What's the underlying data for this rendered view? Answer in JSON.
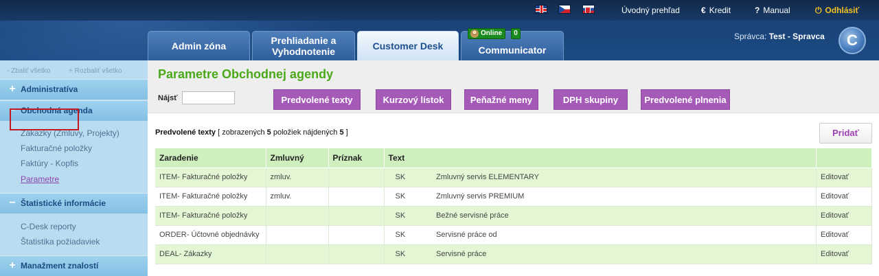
{
  "header": {
    "flags": [
      "uk-flag",
      "cz-flag",
      "sk-flag"
    ],
    "links": {
      "overview": "Úvodný prehľad",
      "credit": "Kredit",
      "manual": "Manual",
      "logout": "Odhlásiť"
    },
    "credit_icon": "€",
    "manual_icon": "?",
    "logout_icon": "⏻",
    "tabs": [
      "Admin zóna",
      "Prehliadanie a Vyhodnotenie",
      "Customer Desk",
      "Communicator"
    ],
    "active_tab": "Customer Desk",
    "online_label": "Online",
    "online_count": "0",
    "admin_label": "Správca:",
    "admin_name": "Test - Spravca",
    "logo_letter": "C"
  },
  "sidebar": {
    "collapse_all": "- Zbaliť všetko",
    "expand_all": "+ Rozbaliť všetko",
    "sections": {
      "administrativa": "Administratíva",
      "obchodna": "Obchodná agenda",
      "statisticke": "Štatistické informácie",
      "manazment": "Manažment znalostí"
    },
    "obchodna_items": [
      "Zákazky (Zmluvy, Projekty)",
      "Fakturačné položky",
      "Faktúry - Kopfis",
      "Parametre"
    ],
    "statisticke_items": [
      "C-Desk reporty",
      "Štatistika požiadaviek"
    ]
  },
  "main": {
    "title": "Parametre Obchodnej agendy",
    "search_label": "Nájsť",
    "search_value": "",
    "buttons": [
      "Predvolené texty",
      "Kurzový lístok",
      "Peňažné meny",
      "DPH skupiny",
      "Predvolené plnenia"
    ],
    "list_title": "Predvolené texty",
    "list_info_prefix": "[ zobrazených",
    "list_shown": "5",
    "list_info_mid": "položiek nájdených",
    "list_found": "5",
    "list_info_suffix": "]",
    "add_button": "Pridať",
    "columns": [
      "Zaradenie",
      "Zmluvný",
      "Príznak",
      "Text",
      ""
    ],
    "rows": [
      {
        "zaradenie": "ITEM- Fakturačné položky",
        "zmluvny": "zmluv.",
        "priznak": "",
        "lang": "SK",
        "text": "Zmluvný servis ELEMENTARY",
        "action": "Editovať"
      },
      {
        "zaradenie": "ITEM- Fakturačné položky",
        "zmluvny": "zmluv.",
        "priznak": "",
        "lang": "SK",
        "text": "Zmluvný servis PREMIUM",
        "action": "Editovať"
      },
      {
        "zaradenie": "ITEM- Fakturačné položky",
        "zmluvny": "",
        "priznak": "",
        "lang": "SK",
        "text": "Bežné servisné práce",
        "action": "Editovať"
      },
      {
        "zaradenie": "ORDER- Účtovné objednávky",
        "zmluvny": "",
        "priznak": "",
        "lang": "SK",
        "text": "Servisné práce od",
        "action": "Editovať"
      },
      {
        "zaradenie": "DEAL- Zákazky",
        "zmluvny": "",
        "priznak": "",
        "lang": "SK",
        "text": "Servisné práce",
        "action": "Editovať"
      }
    ]
  }
}
